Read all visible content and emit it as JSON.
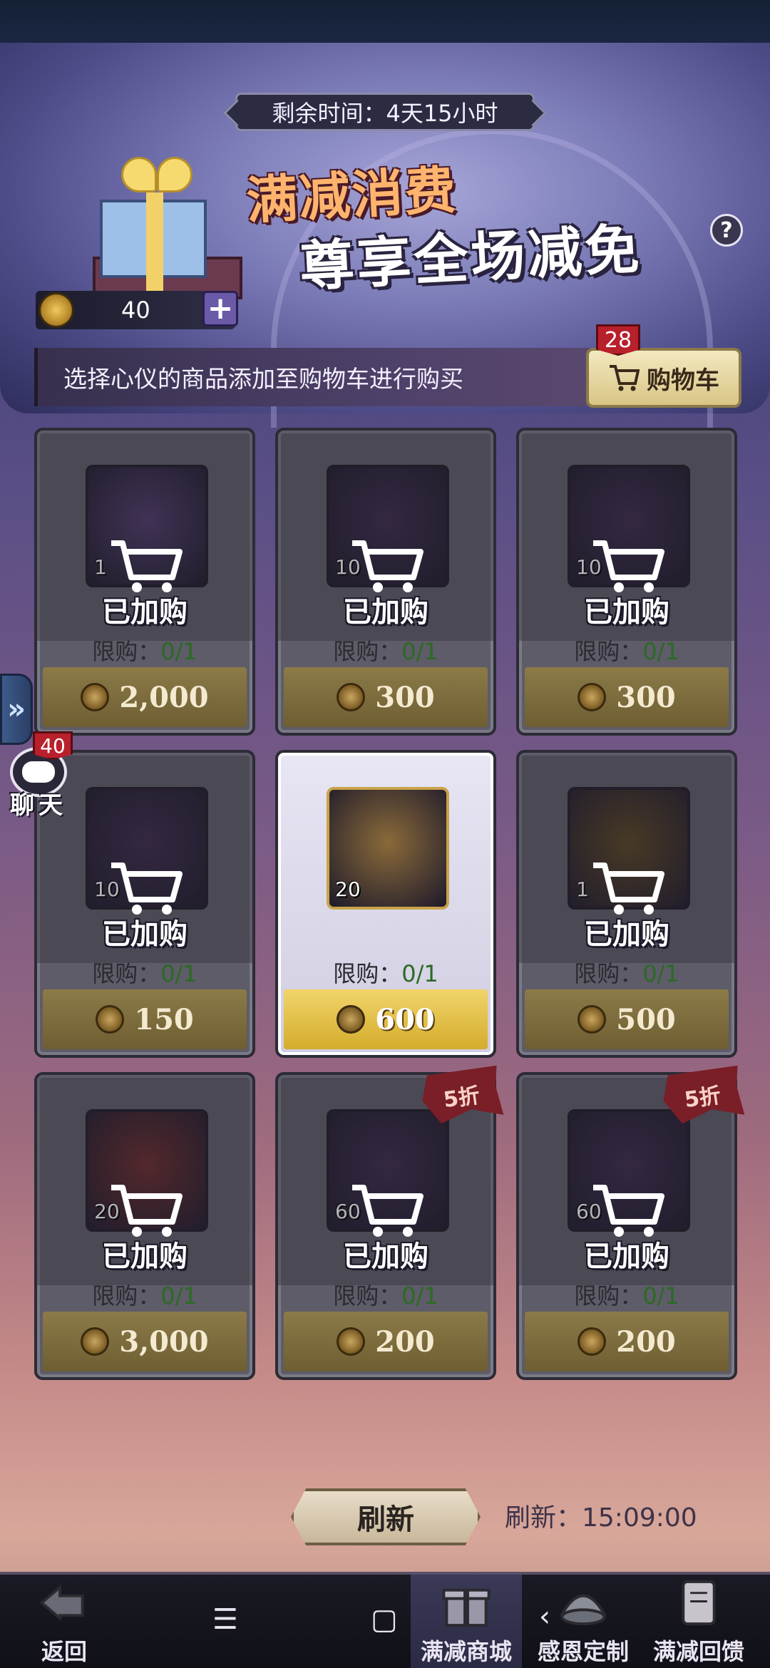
{
  "header": {
    "timer_label": "剩余时间：4天15小时",
    "title_line1": "满减消费",
    "title_line2": "尊享全场减免",
    "help_symbol": "?"
  },
  "currency": {
    "value": "40",
    "plus_symbol": "+"
  },
  "info": {
    "hint": "选择心仪的商品添加至购物车进行购买",
    "cart_label": "购物车",
    "cart_count": "28"
  },
  "items": [
    {
      "qty": "1",
      "added": "已加购",
      "limit_label": "限购：",
      "limit_value": "0/1",
      "price": "2,000",
      "bg": "#4e3a6a",
      "discount": ""
    },
    {
      "qty": "10",
      "added": "已加购",
      "limit_label": "限购：",
      "limit_value": "0/1",
      "price": "300",
      "bg": "#3a2a4a",
      "discount": ""
    },
    {
      "qty": "10",
      "added": "已加购",
      "limit_label": "限购：",
      "limit_value": "0/1",
      "price": "300",
      "bg": "#3a2a4a",
      "discount": ""
    },
    {
      "qty": "10",
      "added": "已加购",
      "limit_label": "限购：",
      "limit_value": "0/1",
      "price": "150",
      "bg": "#3a2a4a",
      "discount": ""
    },
    {
      "qty": "20",
      "added": "",
      "limit_label": "限购：",
      "limit_value": "0/1",
      "price": "600",
      "bg": "#8a6a3a",
      "discount": ""
    },
    {
      "qty": "1",
      "added": "已加购",
      "limit_label": "限购：",
      "limit_value": "0/1",
      "price": "500",
      "bg": "#5a4520",
      "discount": ""
    },
    {
      "qty": "20",
      "added": "已加购",
      "limit_label": "限购：",
      "limit_value": "0/1",
      "price": "3,000",
      "bg": "#6a2a2a",
      "discount": ""
    },
    {
      "qty": "60",
      "added": "已加购",
      "limit_label": "限购：",
      "limit_value": "0/1",
      "price": "200",
      "bg": "#3a2a4a",
      "discount": "5折"
    },
    {
      "qty": "60",
      "added": "已加购",
      "limit_label": "限购：",
      "limit_value": "0/1",
      "price": "200",
      "bg": "#3a2a4a",
      "discount": "5折"
    }
  ],
  "side": {
    "expand_symbol": "»",
    "chat_label": "聊天",
    "chat_count": "40"
  },
  "refresh": {
    "button_label": "刷新",
    "time_label": "刷新：15:09:00"
  },
  "nav": {
    "back": "返回",
    "shop": "满减商城",
    "custom": "感恩定制",
    "feedback": "满减回馈",
    "menu_symbol": "☰",
    "home_symbol": "▢",
    "back_symbol": "‹"
  },
  "colors": {
    "accent_gold": "#d4ac2c",
    "limit_green": "#2b6a22",
    "badge_red": "#b8202c"
  }
}
